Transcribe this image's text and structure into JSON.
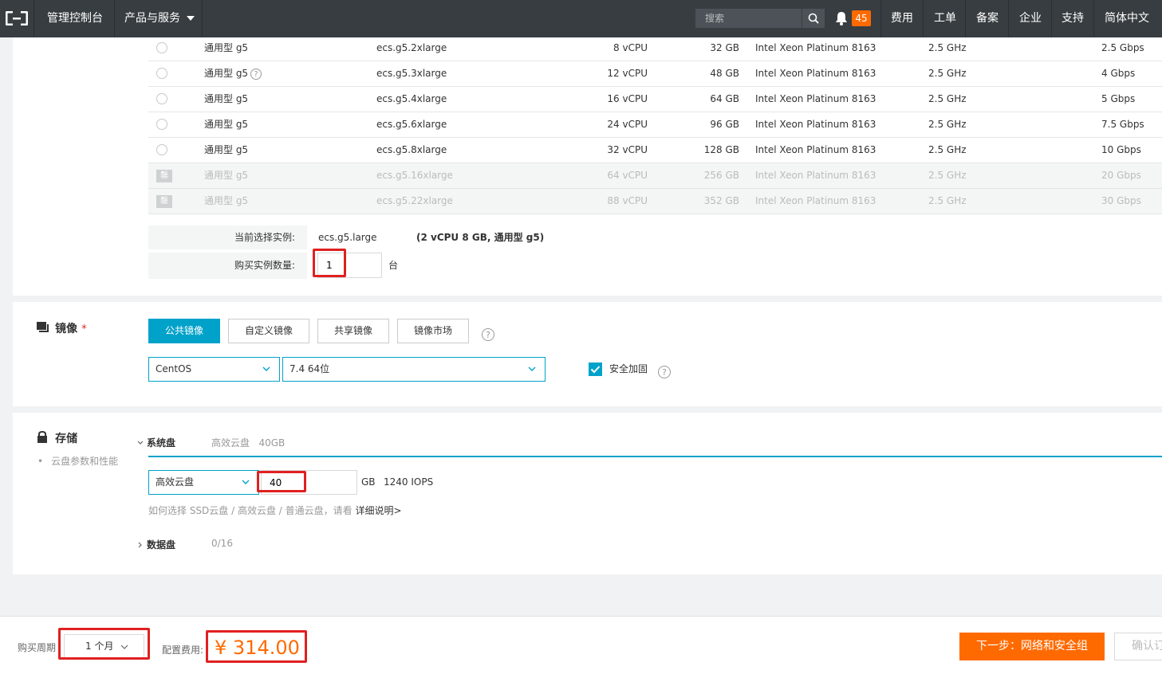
{
  "topbar": {
    "console": "管理控制台",
    "products": "产品与服务",
    "search_placeholder": "搜索",
    "notifications": "45",
    "links": [
      "费用",
      "工单",
      "备案",
      "企业",
      "支持",
      "简体中文"
    ]
  },
  "instances": [
    {
      "family": "通用型 g5",
      "type": "ecs.g5.2xlarge",
      "vcpu": "8 vCPU",
      "mem": "32 GB",
      "cpu": "Intel Xeon Platinum 8163",
      "freq": "2.5 GHz",
      "bw": "2.5 Gbps",
      "status": "radio",
      "help": false
    },
    {
      "family": "通用型 g5",
      "type": "ecs.g5.3xlarge",
      "vcpu": "12 vCPU",
      "mem": "48 GB",
      "cpu": "Intel Xeon Platinum 8163",
      "freq": "2.5 GHz",
      "bw": "4 Gbps",
      "status": "radio",
      "help": true
    },
    {
      "family": "通用型 g5",
      "type": "ecs.g5.4xlarge",
      "vcpu": "16 vCPU",
      "mem": "64 GB",
      "cpu": "Intel Xeon Platinum 8163",
      "freq": "2.5 GHz",
      "bw": "5 Gbps",
      "status": "radio",
      "help": false
    },
    {
      "family": "通用型 g5",
      "type": "ecs.g5.6xlarge",
      "vcpu": "24 vCPU",
      "mem": "96 GB",
      "cpu": "Intel Xeon Platinum 8163",
      "freq": "2.5 GHz",
      "bw": "7.5 Gbps",
      "status": "radio",
      "help": false
    },
    {
      "family": "通用型 g5",
      "type": "ecs.g5.8xlarge",
      "vcpu": "32 vCPU",
      "mem": "128 GB",
      "cpu": "Intel Xeon Platinum 8163",
      "freq": "2.5 GHz",
      "bw": "10 Gbps",
      "status": "radio",
      "help": false
    },
    {
      "family": "通用型 g5",
      "type": "ecs.g5.16xlarge",
      "vcpu": "64 vCPU",
      "mem": "256 GB",
      "cpu": "Intel Xeon Platinum 8163",
      "freq": "2.5 GHz",
      "bw": "20 Gbps",
      "status": "soldout",
      "help": false
    },
    {
      "family": "通用型 g5",
      "type": "ecs.g5.22xlarge",
      "vcpu": "88 vCPU",
      "mem": "352 GB",
      "cpu": "Intel Xeon Platinum 8163",
      "freq": "2.5 GHz",
      "bw": "30 Gbps",
      "status": "soldout",
      "help": false
    }
  ],
  "soldout_label": "罄",
  "help_glyph": "?",
  "selection": {
    "current_label": "当前选择实例:",
    "current_value": "ecs.g5.large",
    "current_spec": "(2 vCPU 8 GB, 通用型 g5)",
    "quantity_label": "购买实例数量:",
    "quantity_value": "1",
    "quantity_unit": "台"
  },
  "image": {
    "title": "镜像",
    "required_mark": "*",
    "tabs": [
      "公共镜像",
      "自定义镜像",
      "共享镜像",
      "镜像市场"
    ],
    "os": "CentOS",
    "version": "7.4 64位",
    "security_label": "安全加固",
    "security_checked": true
  },
  "storage": {
    "title": "存储",
    "link": "云盘参数和性能",
    "system_disk_label": "系统盘",
    "system_disk_summary": "高效云盘   40GB",
    "disk_type": "高效云盘",
    "size": "40",
    "unit": "GB",
    "iops": "1240 IOPS",
    "hint": "如何选择 SSD云盘 / 高效云盘 / 普通云盘，请看",
    "hint_link": "详细说明>",
    "data_disk_label": "数据盘",
    "data_disk_count": "0/16"
  },
  "footer": {
    "period_label": "购买周期",
    "period_value": "1 个月",
    "fee_label": "配置费用:",
    "price": "¥ 314.00",
    "next_button": "下一步：网络和安全组",
    "confirm_button": "确认订"
  },
  "colors": {
    "accent": "#00a2ca",
    "orange": "#ff6a00",
    "topbar": "#373d41",
    "highlight": "#e02020"
  }
}
